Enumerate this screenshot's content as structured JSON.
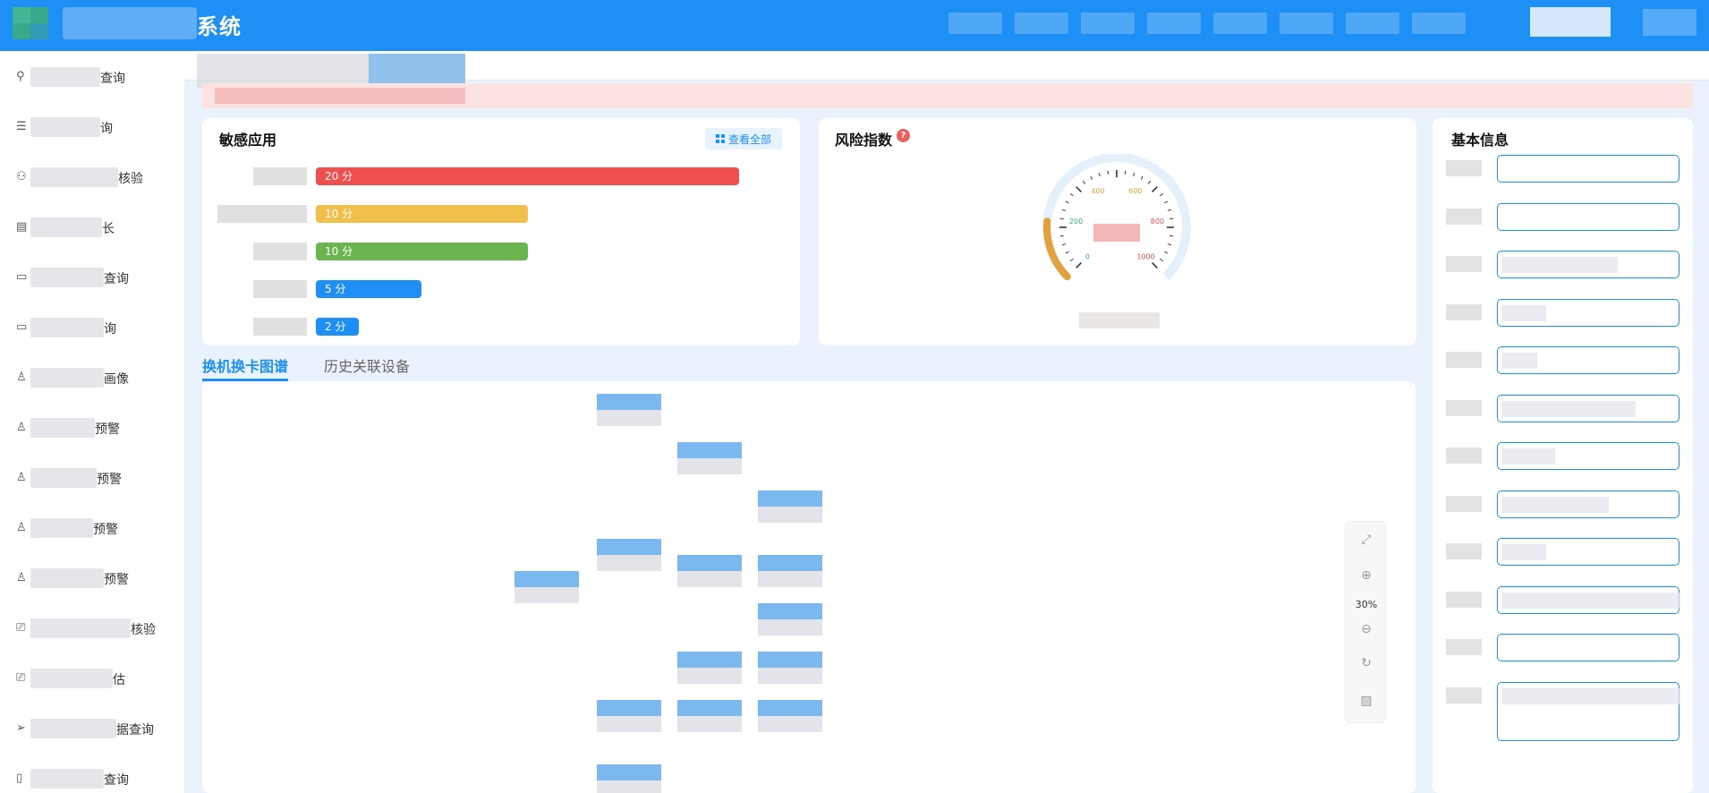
{
  "header": {
    "title_suffix": "系统"
  },
  "sidebar": {
    "items": [
      {
        "icon": "search-icon",
        "glyph": "⚲",
        "suffix": "查询"
      },
      {
        "icon": "list-icon",
        "glyph": "☰",
        "suffix": "询"
      },
      {
        "icon": "user-group-icon",
        "glyph": "⚇",
        "suffix": "核验"
      },
      {
        "icon": "layout-icon",
        "glyph": "▤",
        "suffix": "长"
      },
      {
        "icon": "card-icon",
        "glyph": "▭",
        "suffix": "查询"
      },
      {
        "icon": "card-icon",
        "glyph": "▭",
        "suffix": "询"
      },
      {
        "icon": "user-icon",
        "glyph": "♙",
        "suffix": "画像"
      },
      {
        "icon": "user-icon",
        "glyph": "♙",
        "suffix": "预警"
      },
      {
        "icon": "user-icon",
        "glyph": "♙",
        "suffix": "预警"
      },
      {
        "icon": "user-icon",
        "glyph": "♙",
        "suffix": "预警"
      },
      {
        "icon": "user-icon",
        "glyph": "♙",
        "suffix": "预警"
      },
      {
        "icon": "device-icon",
        "glyph": "⎚",
        "suffix": "核验"
      },
      {
        "icon": "device-icon",
        "glyph": "⎚",
        "suffix": "估"
      },
      {
        "icon": "send-icon",
        "glyph": "➢",
        "suffix": "据查询"
      },
      {
        "icon": "doc-icon",
        "glyph": "▯",
        "suffix": "查询"
      }
    ]
  },
  "sensitive_apps": {
    "title": "敏感应用",
    "view_all": "查看全部",
    "items": [
      {
        "score": "20 分",
        "value": 20,
        "color": "#ef4f4f"
      },
      {
        "score": "10 分",
        "value": 10,
        "color": "#f0c04a"
      },
      {
        "score": "10 分",
        "value": 10,
        "color": "#6bb54f"
      },
      {
        "score": "5 分",
        "value": 5,
        "color": "#1d8ff5"
      },
      {
        "score": "2 分",
        "value": 2,
        "color": "#1d8ff5"
      }
    ]
  },
  "risk": {
    "title": "风险指数",
    "help": "?",
    "gauge_ticks": [
      {
        "label": "0",
        "color": "#2fb06a"
      },
      {
        "label": "200",
        "color": "#2fb06a"
      },
      {
        "label": "400",
        "color": "#e6a23c"
      },
      {
        "label": "600",
        "color": "#e6a23c"
      },
      {
        "label": "800",
        "color": "#e05050"
      },
      {
        "label": "1000",
        "color": "#e05050"
      }
    ]
  },
  "tabs": {
    "active": "换机换卡图谱",
    "inactive": "历史关联设备"
  },
  "zoom": {
    "level": "30%"
  },
  "basic_info": {
    "title": "基本信息"
  }
}
